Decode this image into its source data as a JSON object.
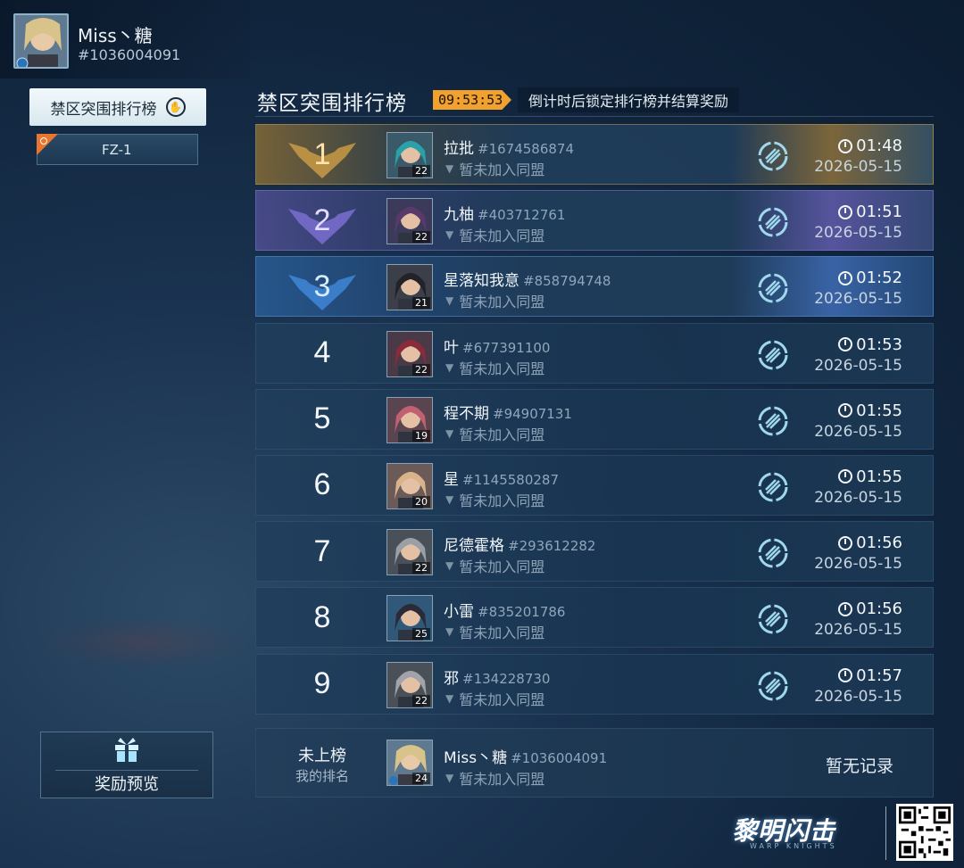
{
  "profile": {
    "name": "Miss丶糖",
    "id": "#1036004091"
  },
  "sidebar": {
    "active_tab": "禁区突围排行榜",
    "sub_tab": "FZ-1",
    "reward_preview": "奖励预览"
  },
  "board": {
    "title": "禁区突围排行榜",
    "countdown": "09:53:53",
    "countdown_note": "倒计时后锁定排行榜并结算奖励"
  },
  "rows": [
    {
      "rank": "1",
      "name": "拉批",
      "id": "#1674586874",
      "level": "22",
      "alliance": "暂未加入同盟",
      "time": "01:48",
      "date": "2026-05-15"
    },
    {
      "rank": "2",
      "name": "九柚",
      "id": "#403712761",
      "level": "22",
      "alliance": "暂未加入同盟",
      "time": "01:51",
      "date": "2026-05-15"
    },
    {
      "rank": "3",
      "name": "星落知我意",
      "id": "#858794748",
      "level": "21",
      "alliance": "暂未加入同盟",
      "time": "01:52",
      "date": "2026-05-15"
    },
    {
      "rank": "4",
      "name": "叶",
      "id": "#677391100",
      "level": "22",
      "alliance": "暂未加入同盟",
      "time": "01:53",
      "date": "2026-05-15"
    },
    {
      "rank": "5",
      "name": "程不期",
      "id": "#94907131",
      "level": "19",
      "alliance": "暂未加入同盟",
      "time": "01:55",
      "date": "2026-05-15"
    },
    {
      "rank": "6",
      "name": "星",
      "id": "#1145580287",
      "level": "20",
      "alliance": "暂未加入同盟",
      "time": "01:55",
      "date": "2026-05-15"
    },
    {
      "rank": "7",
      "name": "尼德霍格",
      "id": "#293612282",
      "level": "22",
      "alliance": "暂未加入同盟",
      "time": "01:56",
      "date": "2026-05-15"
    },
    {
      "rank": "8",
      "name": "小雷",
      "id": "#835201786",
      "level": "25",
      "alliance": "暂未加入同盟",
      "time": "01:56",
      "date": "2026-05-15"
    },
    {
      "rank": "9",
      "name": "邪",
      "id": "#134228730",
      "level": "22",
      "alliance": "暂未加入同盟",
      "time": "01:57",
      "date": "2026-05-15"
    }
  ],
  "mine": {
    "status": "未上榜",
    "label": "我的排名",
    "name": "Miss丶糖",
    "id": "#1036004091",
    "level": "24",
    "alliance": "暂未加入同盟",
    "record": "暂无记录"
  },
  "logo": {
    "text": "黎明闪击",
    "sub": "WARP KNIGHTS"
  },
  "colors": {
    "gold": "#c99a45",
    "purple": "#7a6fd0",
    "blue": "#3f86d6",
    "accent_orange": "#f0a12e"
  }
}
